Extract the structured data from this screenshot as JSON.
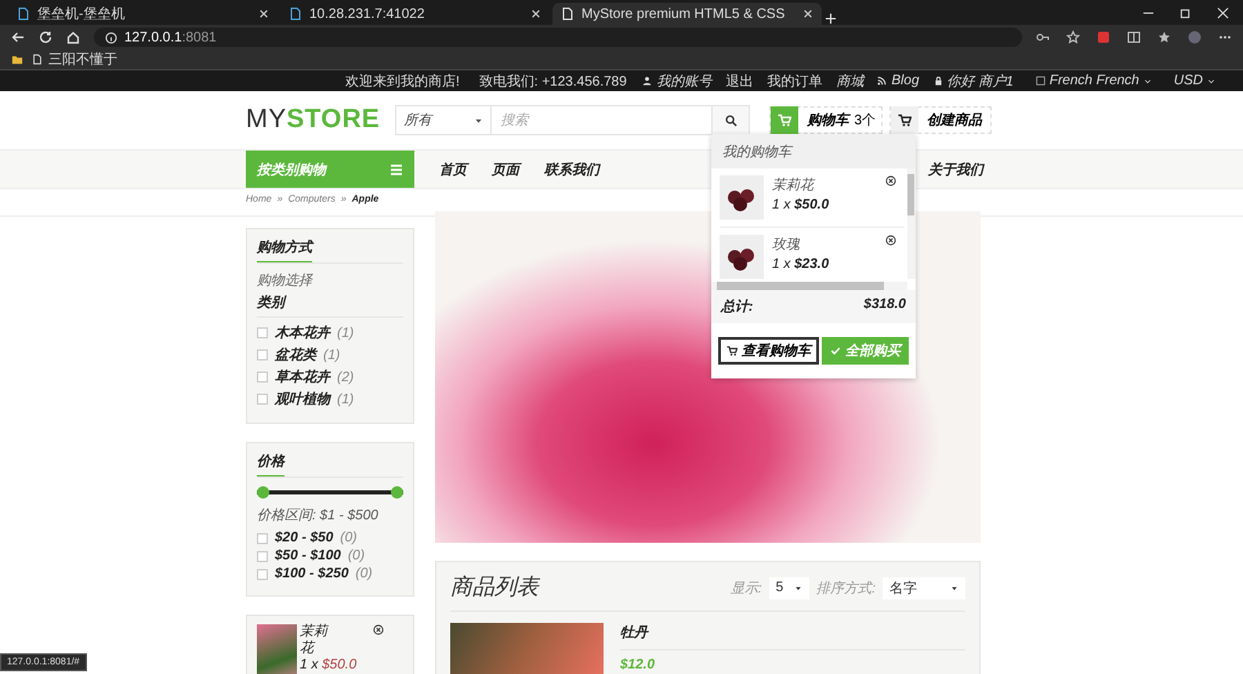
{
  "browser": {
    "tabs": [
      {
        "title": "堡垒机-堡垒机",
        "selected": false
      },
      {
        "title": "10.28.231.7:41022",
        "selected": false
      },
      {
        "title": "MyStore premium HTML5 & CSS",
        "selected": true
      }
    ],
    "url_host": "127.0.0.1",
    "url_port": ":8081",
    "bookmarks": [
      "三阳不懂于"
    ]
  },
  "topbar": {
    "welcome": "欢迎来到我的商店!",
    "phone": "致电我们: +123.456.789",
    "links": [
      {
        "kind": "user",
        "label": "我的账号"
      },
      {
        "kind": "plain",
        "label": "退出"
      },
      {
        "kind": "plain",
        "label": "我的订单"
      },
      {
        "kind": "italic",
        "label": "商城"
      },
      {
        "kind": "rss",
        "label": "Blog"
      },
      {
        "kind": "lock",
        "label": "你好 商户1"
      }
    ],
    "language_image_alt": "French",
    "language": "French",
    "currency": "USD"
  },
  "header": {
    "logo_dark": "MY",
    "logo_accent": "STORE",
    "search_category": "所有",
    "search_placeholder": "搜索",
    "cart_label": "购物车",
    "cart_count": "3个",
    "create_label": "创建商品"
  },
  "nav": {
    "category_button": "按类别购物",
    "items": [
      "首页",
      "页面",
      "联系我们",
      "关于我们"
    ]
  },
  "breadcrumb_separator": "»",
  "breadcrumb": [
    {
      "label": "Home",
      "current": false
    },
    {
      "label": "Computers",
      "current": false
    },
    {
      "label": "Apple",
      "current": true
    }
  ],
  "sidebar": {
    "title": "购物方式",
    "subtitle": "购物选择",
    "group": "类别",
    "filters": [
      {
        "label": "木本花卉",
        "count": "(1)",
        "checked": false
      },
      {
        "label": "盆花类",
        "count": "(1)",
        "checked": false
      },
      {
        "label": "草本花卉",
        "count": "(2)",
        "checked": false
      },
      {
        "label": "观叶植物",
        "count": "(1)",
        "checked": false
      }
    ],
    "price_title": "价格",
    "price_slider": {
      "level": 1
    },
    "price_range": "价格区间: $1 - $500",
    "price_filters": [
      {
        "label": "$20 - $50",
        "count": "(0)",
        "checked": false
      },
      {
        "label": "$50 - $100",
        "count": "(0)",
        "checked": false
      },
      {
        "label": "$100 - $250",
        "count": "(0)",
        "checked": false
      }
    ],
    "mini_cart": [
      {
        "name": "茉莉花",
        "qty": "1 x",
        "price": "$50.0"
      }
    ]
  },
  "products": {
    "title": "商品列表",
    "show_label": "显示:",
    "show_value": "5",
    "sort_label": "排序方式:",
    "sort_value": "名字",
    "items": [
      {
        "name": "牡丹",
        "price": "$12.0"
      }
    ]
  },
  "cart_dropdown": {
    "title": "我的购物车",
    "items": [
      {
        "name": "茉莉花",
        "qty": "1 x",
        "price": "$50.0"
      },
      {
        "name": "玫瑰",
        "qty": "1 x",
        "price": "$23.0"
      }
    ],
    "total_label": "总计:",
    "total": "$318.0",
    "view_button": "查看购物车",
    "buy_button": "全部购买"
  },
  "status_url": "127.0.0.1:8081/#"
}
